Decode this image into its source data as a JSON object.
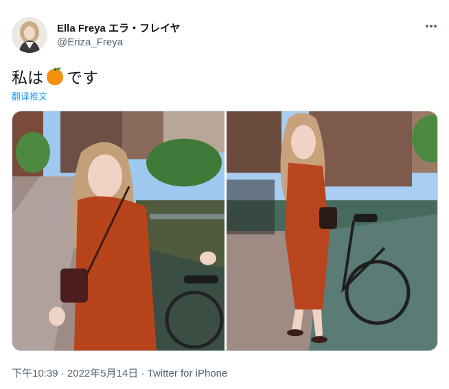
{
  "tweet": {
    "display_name": "Ella Freya エラ・フレイヤ",
    "handle": "@Eriza_Freya",
    "text_before": "私は",
    "emoji": "orange-emoji",
    "text_after": "です",
    "translate_label": "翻译推文",
    "time": "下午10:39",
    "separator": "·",
    "date": "2022年5月14日",
    "source": "Twitter for iPhone"
  },
  "media": {
    "photos": [
      "photo-1",
      "photo-2"
    ]
  },
  "colors": {
    "text": "#0f1419",
    "secondary": "#536471",
    "link": "#1d9bf0",
    "border": "#cfd9de"
  }
}
